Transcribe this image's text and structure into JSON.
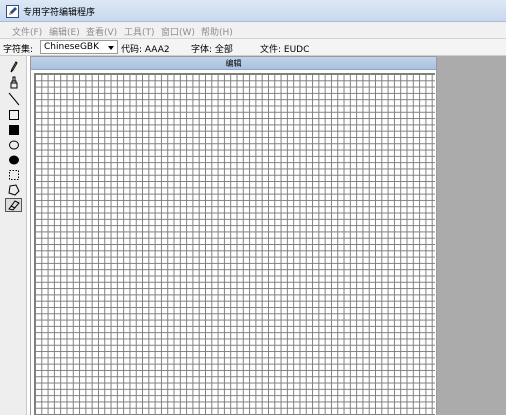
{
  "titlebar": {
    "title": "专用字符编辑程序",
    "icon": "pencil-app-icon"
  },
  "menu": {
    "items": [
      {
        "id": "file",
        "label": "文件(F)"
      },
      {
        "id": "edit",
        "label": "编辑(E)"
      },
      {
        "id": "view",
        "label": "查看(V)"
      },
      {
        "id": "tools",
        "label": "工具(T)"
      },
      {
        "id": "window",
        "label": "窗口(W)"
      },
      {
        "id": "help",
        "label": "帮助(H)"
      }
    ]
  },
  "infobar": {
    "charset_label": "字符集:",
    "charset_value": "ChineseGBK",
    "code_text": "代码: AAA2",
    "font_text": "字体: 全部",
    "file_text": "文件: EUDC"
  },
  "toolbox": {
    "tools": [
      {
        "name": "pencil-icon"
      },
      {
        "name": "brush-icon"
      },
      {
        "name": "line-icon"
      },
      {
        "name": "hollow-rectangle-icon"
      },
      {
        "name": "filled-rectangle-icon"
      },
      {
        "name": "hollow-ellipse-icon"
      },
      {
        "name": "filled-ellipse-icon"
      },
      {
        "name": "rectangular-select-icon"
      },
      {
        "name": "freeform-select-icon"
      },
      {
        "name": "eraser-icon",
        "selected": true
      }
    ]
  },
  "editor": {
    "title": "编辑"
  },
  "colors": {
    "titlebar": "#c7d8ee",
    "grid_line": "#7e7e7e",
    "workspace": "#ababab",
    "edit_title": "#bfd3ea"
  }
}
